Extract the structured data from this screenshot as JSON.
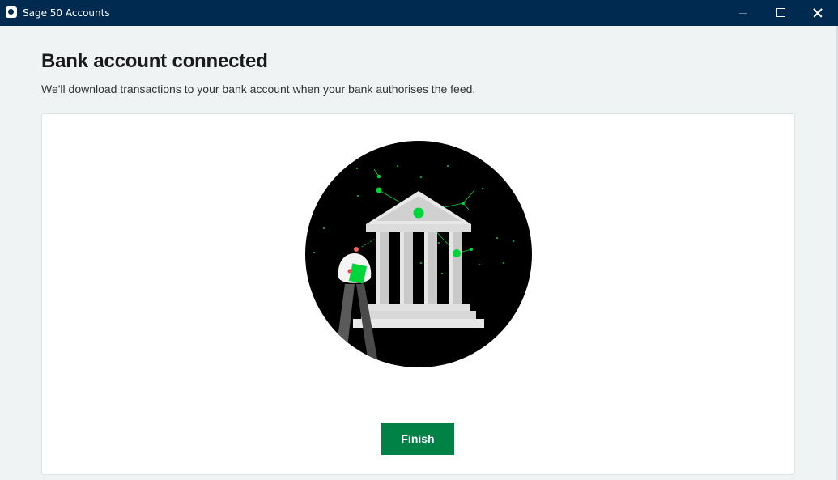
{
  "window": {
    "title": "Sage 50 Accounts",
    "icon": "sage-app-icon",
    "controls": [
      "minimize-icon",
      "maximize-icon",
      "close-icon"
    ]
  },
  "main": {
    "heading": "Bank account connected",
    "subtitle": "We'll download transactions to your bank account when your bank authorises the feed.",
    "illustration": "bank-building-illustration",
    "finish_label": "Finish"
  },
  "colors": {
    "titlebar": "#002a4f",
    "page_background": "#f0f3f4",
    "accent_green": "#008146",
    "illustration_green": "#00d639"
  }
}
